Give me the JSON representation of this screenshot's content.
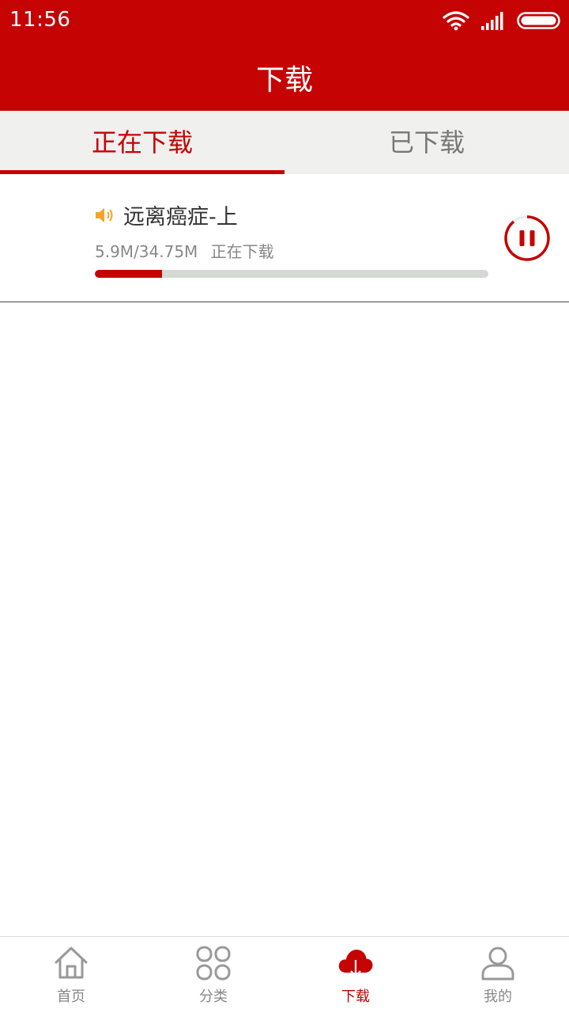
{
  "status_bar": {
    "time": "11:56"
  },
  "app_bar": {
    "title": "下载"
  },
  "tabs": [
    {
      "label": "正在下载",
      "active": true
    },
    {
      "label": "已下载",
      "active": false
    }
  ],
  "downloads": [
    {
      "title": "远离癌症-上",
      "size_text": "5.9M/34.75M",
      "status_text": "正在下载",
      "progress_fraction": 0.17,
      "type_icon": "speaker-icon",
      "action_icon": "pause-icon"
    }
  ],
  "bottom_nav": [
    {
      "label": "首页",
      "icon": "home-icon",
      "active": false
    },
    {
      "label": "分类",
      "icon": "category-grid-icon",
      "active": false
    },
    {
      "label": "下载",
      "icon": "cloud-download-icon",
      "active": true
    },
    {
      "label": "我的",
      "icon": "user-icon",
      "active": false
    }
  ],
  "colors": {
    "brand_red": "#c50303",
    "tab_bg": "#f0f0ee",
    "progress_track": "#d4dad3",
    "speaker": "#f4a423"
  }
}
